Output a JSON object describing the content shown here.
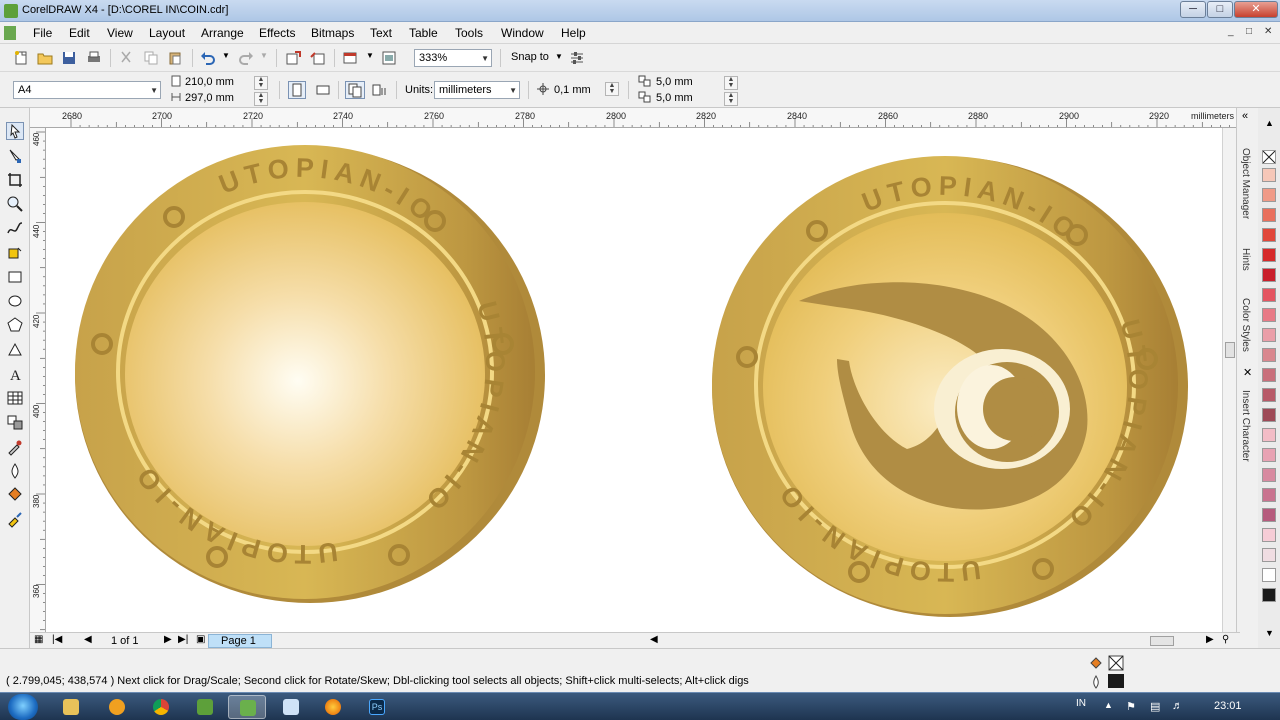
{
  "window": {
    "title": "CorelDRAW X4 - [D:\\COREL IN\\COIN.cdr]",
    "min_glyph": "─",
    "max_glyph": "□",
    "close_glyph": "✕"
  },
  "menu": {
    "items": [
      "File",
      "Edit",
      "View",
      "Layout",
      "Arrange",
      "Effects",
      "Bitmaps",
      "Text",
      "Table",
      "Tools",
      "Window",
      "Help"
    ]
  },
  "toolbar1": {
    "zoom": "333%",
    "snap_to": "Snap to"
  },
  "property_bar": {
    "paper": "A4",
    "width": "210,0 mm",
    "height": "297,0 mm",
    "units_label": "Units:",
    "units": "millimeters",
    "nudge": "0,1 mm",
    "dup_x": "5,0 mm",
    "dup_y": "5,0 mm"
  },
  "ruler": {
    "h_labels": [
      "2680",
      "2700",
      "2720",
      "2740",
      "2760",
      "2780",
      "2800",
      "2820",
      "2840",
      "2860",
      "2880",
      "2900",
      "2920"
    ],
    "h_unit": "millimeters",
    "v_labels": [
      "460",
      "440",
      "420",
      "400",
      "380",
      "360"
    ],
    "v_unit": "millimeters"
  },
  "coins": {
    "ring_text": "UTOPIAN-IO",
    "colors": {
      "rim": "#b48f3c",
      "face": "#d9b84a",
      "inner_light": "#fdf5dc",
      "logo": "#b38e45"
    }
  },
  "dockers": {
    "tabs": [
      "Object Manager",
      "Hints",
      "Color Styles",
      "Insert Character"
    ]
  },
  "palette": {
    "colors": [
      "#f6c7b8",
      "#f09a87",
      "#e9705d",
      "#e1473a",
      "#d62a2a",
      "#c91f2b",
      "#e45561",
      "#e87a86",
      "#ea9ea8",
      "#d9878e",
      "#c96f7b",
      "#b85a68",
      "#9e4a57",
      "#f3bcc6",
      "#e8a2b3",
      "#d88aa0",
      "#c9738f",
      "#b65b7d",
      "#f6ccd6",
      "#f0dde2",
      "#ffffff",
      "#1a1a1a"
    ]
  },
  "pagebar": {
    "page_count": "1 of 1",
    "page_tab": "Page 1"
  },
  "status": {
    "message": "( 2.799,045; 438,574 )  Next click for Drag/Scale; Second click for Rotate/Skew; Dbl-clicking tool selects all objects; Shift+click multi-selects; Alt+click digs"
  },
  "taskbar": {
    "lang": "IN",
    "clock": "23:01"
  }
}
